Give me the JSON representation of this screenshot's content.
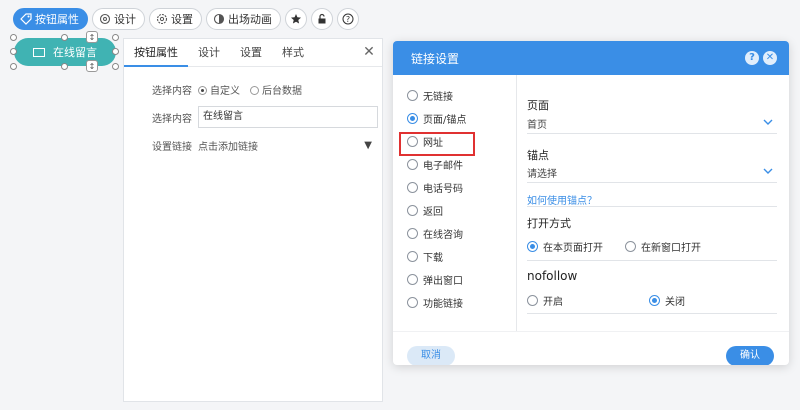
{
  "toolbar": {
    "button_props": "按钮属性",
    "design": "设计",
    "settings": "设置",
    "entrance_animation": "出场动画"
  },
  "widget": {
    "label": "在线留言"
  },
  "props_panel": {
    "tabs": [
      "按钮属性",
      "设计",
      "设置",
      "样式"
    ],
    "select_content_label": "选择内容",
    "option_custom": "自定义",
    "option_backend": "后台数据",
    "content_label": "选择内容",
    "content_value": "在线留言",
    "link_label": "设置链接",
    "link_value": "点击添加链接"
  },
  "dialog": {
    "title": "链接设置",
    "link_types": [
      "无链接",
      "页面/锚点",
      "网址",
      "电子邮件",
      "电话号码",
      "返回",
      "在线咨询",
      "下载",
      "弹出窗口",
      "功能链接"
    ],
    "selected_link_type": "页面/锚点",
    "page_label": "页面",
    "page_value": "首页",
    "anchor_label": "锚点",
    "anchor_value": "请选择",
    "help_link": "如何使用锚点？",
    "open_mode_label": "打开方式",
    "open_current": "在本页面打开",
    "open_new": "在新窗口打开",
    "nofollow_label": "nofollow",
    "nofollow_on": "开启",
    "nofollow_off": "关闭",
    "cancel": "取消",
    "confirm": "确认"
  },
  "colors": {
    "accent": "#3a8ee6",
    "widget": "#40b3b3",
    "highlight": "#e03131"
  }
}
